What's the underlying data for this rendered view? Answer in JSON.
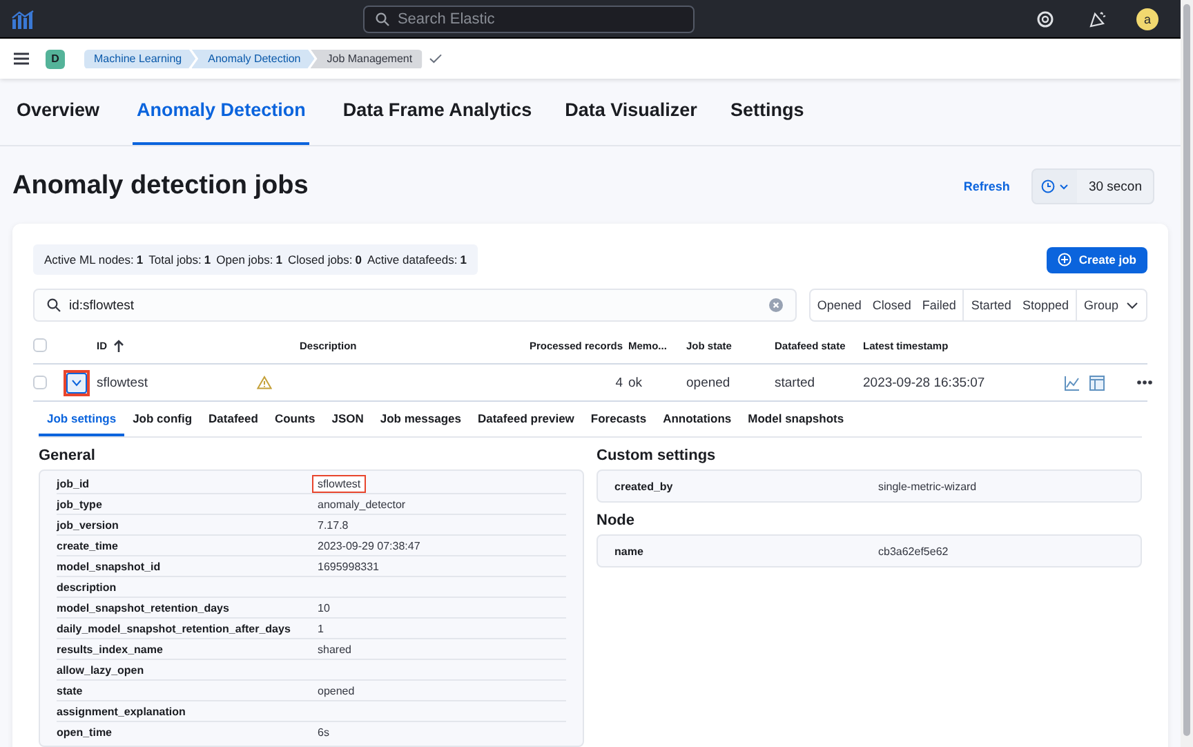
{
  "header": {
    "search_placeholder": "Search Elastic",
    "avatar": "a"
  },
  "breadcrumbs": {
    "space": "D",
    "items": [
      {
        "label": "Machine Learning",
        "current": false
      },
      {
        "label": "Anomaly Detection",
        "current": false
      },
      {
        "label": "Job Management",
        "current": true
      }
    ]
  },
  "tabs": [
    {
      "label": "Overview",
      "selected": false
    },
    {
      "label": "Anomaly Detection",
      "selected": true
    },
    {
      "label": "Data Frame Analytics",
      "selected": false
    },
    {
      "label": "Data Visualizer",
      "selected": false
    },
    {
      "label": "Settings",
      "selected": false
    }
  ],
  "page": {
    "title": "Anomaly detection jobs",
    "refresh": "Refresh",
    "interval": "30 secon"
  },
  "stats": [
    {
      "label": "Active ML nodes:",
      "value": "1"
    },
    {
      "label": "Total jobs:",
      "value": "1"
    },
    {
      "label": "Open jobs:",
      "value": "1"
    },
    {
      "label": "Closed jobs:",
      "value": "0"
    },
    {
      "label": "Active datafeeds:",
      "value": "1"
    }
  ],
  "create_button": "Create job",
  "search": {
    "value": "id:sflowtest"
  },
  "filter_groups": [
    [
      "Opened",
      "Closed",
      "Failed"
    ],
    [
      "Started",
      "Stopped"
    ]
  ],
  "group_button": "Group",
  "table": {
    "columns": [
      {
        "label": "ID",
        "sorted": true
      },
      {
        "label": "Description"
      },
      {
        "label": "Processed records"
      },
      {
        "label": "Memo..."
      },
      {
        "label": "Job state"
      },
      {
        "label": "Datafeed state"
      },
      {
        "label": "Latest timestamp"
      }
    ],
    "select_all_checked": false,
    "rows": [
      {
        "checked": false,
        "expanded": true,
        "highlighted": true,
        "warning": true,
        "cells": [
          "sflowtest",
          "",
          "4",
          "ok",
          "opened",
          "started",
          "2023-09-28 16:35:07"
        ]
      }
    ]
  },
  "detail_tabs": [
    {
      "label": "Job settings",
      "selected": true
    },
    {
      "label": "Job config",
      "selected": false
    },
    {
      "label": "Datafeed",
      "selected": false
    },
    {
      "label": "Counts",
      "selected": false
    },
    {
      "label": "JSON",
      "selected": false
    },
    {
      "label": "Job messages",
      "selected": false
    },
    {
      "label": "Datafeed preview",
      "selected": false
    },
    {
      "label": "Forecasts",
      "selected": false
    },
    {
      "label": "Annotations",
      "selected": false
    },
    {
      "label": "Model snapshots",
      "selected": false
    }
  ],
  "general": {
    "title": "General",
    "rows": [
      {
        "key": "job_id",
        "value": "sflowtest",
        "highlighted": true
      },
      {
        "key": "job_type",
        "value": "anomaly_detector"
      },
      {
        "key": "job_version",
        "value": "7.17.8"
      },
      {
        "key": "create_time",
        "value": "2023-09-29 07:38:47"
      },
      {
        "key": "model_snapshot_id",
        "value": "1695998331"
      },
      {
        "key": "description"
      },
      {
        "key": "model_snapshot_retention_days",
        "value": "10"
      },
      {
        "key": "daily_model_snapshot_retention_after_days",
        "value": "1"
      },
      {
        "key": "results_index_name",
        "value": "shared"
      },
      {
        "key": "allow_lazy_open"
      },
      {
        "key": "state",
        "value": "opened"
      },
      {
        "key": "assignment_explanation"
      },
      {
        "key": "open_time",
        "value": "6s"
      }
    ]
  },
  "custom_settings": {
    "title": "Custom settings",
    "rows": [
      {
        "key": "created_by",
        "value": "single-metric-wizard"
      }
    ]
  },
  "node": {
    "title": "Node",
    "rows": [
      {
        "key": "name",
        "value": "cb3a62ef5e62"
      }
    ]
  }
}
